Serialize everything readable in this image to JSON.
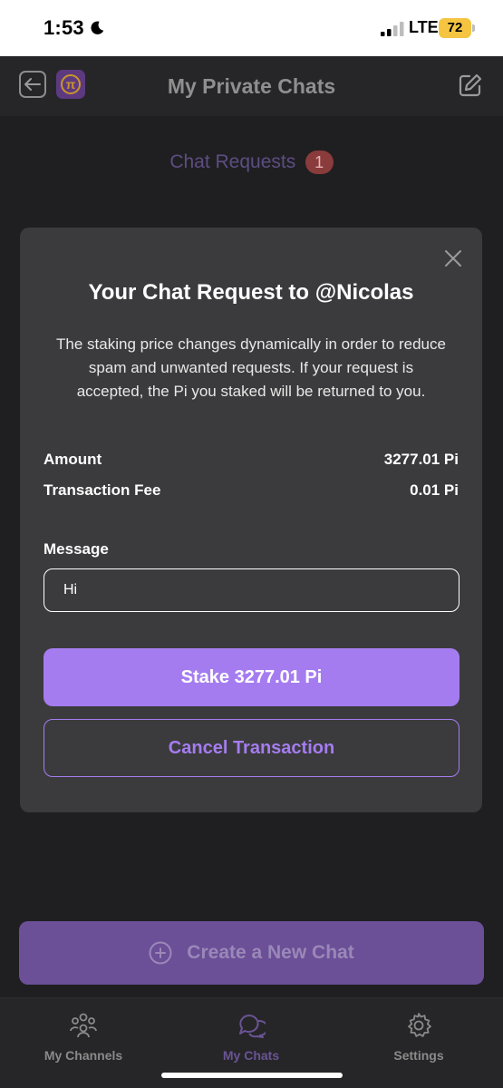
{
  "status_bar": {
    "time": "1:53",
    "network": "LTE",
    "battery": "72",
    "icons": [
      "moon-icon",
      "signal-icon"
    ]
  },
  "header": {
    "title": "My Private Chats",
    "icons": [
      "back-arrow-icon",
      "pi-logo",
      "compose-icon"
    ]
  },
  "chat_requests": {
    "label": "Chat Requests",
    "count": "1"
  },
  "modal": {
    "title": "Your Chat Request to @Nicolas",
    "description": "The staking price changes dynamically in order to reduce spam and unwanted requests. If your request is accepted, the Pi you staked will be returned to you.",
    "amount_label": "Amount",
    "amount_value": "3277.01 Pi",
    "fee_label": "Transaction Fee",
    "fee_value": "0.01 Pi",
    "message_label": "Message",
    "message_value": "Hi",
    "stake_button": "Stake 3277.01 Pi",
    "cancel_button": "Cancel Transaction"
  },
  "create_button": {
    "label": "Create a New Chat",
    "icon": "plus-circle-icon"
  },
  "tabbar": {
    "tabs": [
      {
        "label": "My Channels",
        "icon": "channels-icon",
        "active": false
      },
      {
        "label": "My Chats",
        "icon": "chats-icon",
        "active": true
      },
      {
        "label": "Settings",
        "icon": "gear-icon",
        "active": false
      }
    ]
  },
  "colors": {
    "accent": "#a57cf0",
    "modal_bg": "#3b3b3d",
    "page_bg": "#1f1f21",
    "badge": "#8a3b3b"
  }
}
